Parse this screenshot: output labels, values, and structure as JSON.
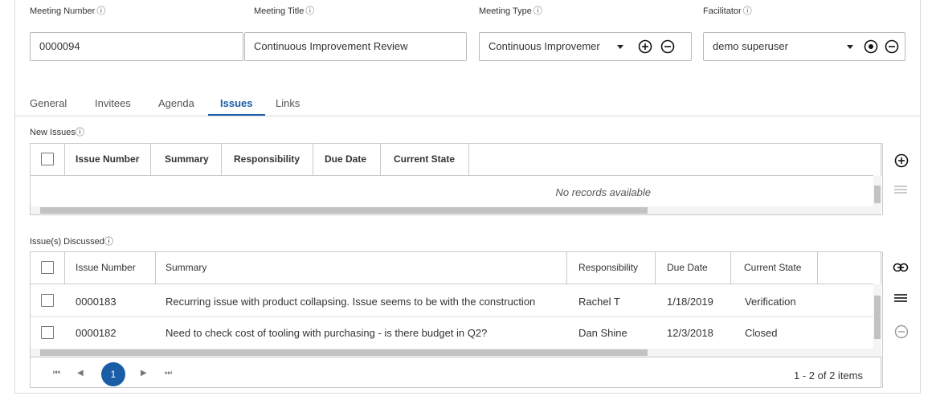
{
  "fields": {
    "meeting_number": {
      "label": "Meeting Number",
      "value": "0000094"
    },
    "meeting_title": {
      "label": "Meeting Title",
      "value": "Continuous Improvement Review"
    },
    "meeting_type": {
      "label": "Meeting Type",
      "value": "Continuous Improvemer"
    },
    "facilitator": {
      "label": "Facilitator",
      "value": "demo superuser"
    },
    "info_glyph": "ⓘ"
  },
  "tabs": [
    {
      "label": "General",
      "active": false
    },
    {
      "label": "Invitees",
      "active": false
    },
    {
      "label": "Agenda",
      "active": false
    },
    {
      "label": "Issues",
      "active": true
    },
    {
      "label": "Links",
      "active": false
    }
  ],
  "new_issues": {
    "label": "New Issues",
    "columns": [
      "Issue Number",
      "Summary",
      "Responsibility",
      "Due Date",
      "Current State"
    ],
    "empty_text": "No records available"
  },
  "discussed": {
    "label": "Issue(s) Discussed",
    "columns": [
      "Issue Number",
      "Summary",
      "Responsibility",
      "Due Date",
      "Current State"
    ],
    "rows": [
      {
        "issue_number": "0000183",
        "summary": "Recurring issue with product collapsing. Issue seems to be with the construction",
        "responsibility": "Rachel T",
        "due_date": "1/18/2019",
        "state": "Verification"
      },
      {
        "issue_number": "0000182",
        "summary": "Need to check cost of tooling with purchasing - is there budget in Q2?",
        "responsibility": "Dan Shine",
        "due_date": "12/3/2018",
        "state": "Closed"
      }
    ],
    "pager": {
      "current_page": "1",
      "summary": "1 - 2 of 2 items"
    }
  },
  "colors": {
    "accent": "#1a5da6"
  },
  "icons": {
    "add": "plus-circle-icon",
    "remove": "minus-circle-icon",
    "radio": "radio-circle-icon",
    "menu": "hamburger-icon",
    "link": "link-icon"
  }
}
